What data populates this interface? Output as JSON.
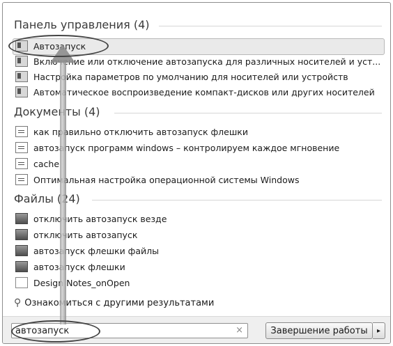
{
  "control_panel": {
    "header": "Панель управления (4)",
    "items": [
      {
        "label": "Автозапуск"
      },
      {
        "label": "Включение или отключение автозапуска для различных носителей и уст..."
      },
      {
        "label": "Настройка параметров по умолчанию для носителей или устройств"
      },
      {
        "label": "Автоматическое воспроизведение компакт-дисков или других носителей"
      }
    ]
  },
  "documents": {
    "header": "Документы (4)",
    "items": [
      {
        "label": "как правильно отключить автозапуск флешки"
      },
      {
        "label": "автозапуск программ windows – контролируем каждое мгновение"
      },
      {
        "label": "cache"
      },
      {
        "label": "Оптимальная настройка операционной системы Windows"
      }
    ]
  },
  "files": {
    "header": "Файлы (24)",
    "items": [
      {
        "label": "отключить автозапуск везде"
      },
      {
        "label": "отключить автозапуск"
      },
      {
        "label": "автозапуск флешки файлы"
      },
      {
        "label": "автозапуск флешки"
      },
      {
        "label": "Design Notes_onOpen"
      }
    ]
  },
  "more_results": "Ознакомиться с другими результатами",
  "search": {
    "value": "автозапуск",
    "clear_glyph": "×"
  },
  "shutdown": {
    "label": "Завершение работы",
    "arrow": "▸"
  }
}
